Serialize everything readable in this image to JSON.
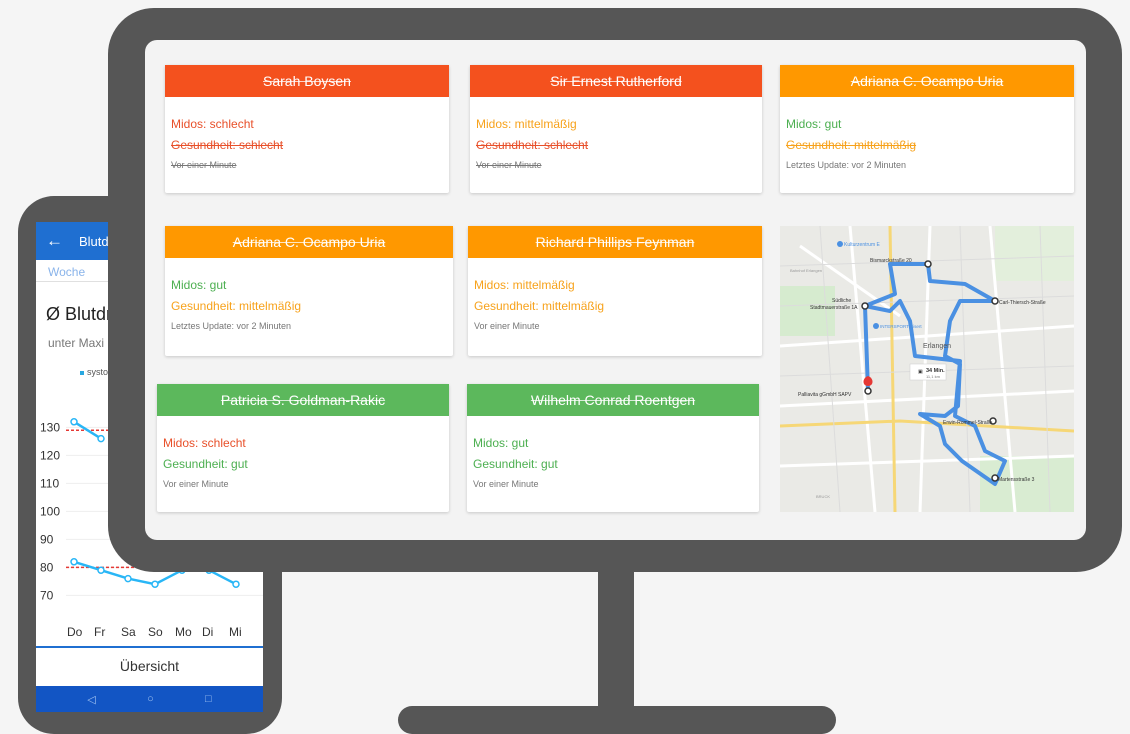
{
  "colors": {
    "red": "#f4511e",
    "orange": "#ff9800",
    "green": "#5cb85c",
    "status_red": "#e8502a",
    "status_orange": "#f7a21b",
    "status_green": "#4caf50",
    "frame": "#565656",
    "phone_blue": "#1f6fd1",
    "route_blue": "#4a90e2"
  },
  "phone": {
    "title": "Blutdr",
    "tab": "Woche",
    "heading": "Ø Blutdr",
    "subtitle": "unter Maxi",
    "legend": "systo",
    "bottom_button": "Übersicht",
    "nav_icons": [
      "back-triangle",
      "home-circle",
      "recents-square"
    ],
    "nav_glyphs": [
      "◁",
      "○",
      "□"
    ]
  },
  "chart_data": {
    "type": "line",
    "categories": [
      "Do",
      "Fr",
      "Sa",
      "So",
      "Mo",
      "Di",
      "Mi"
    ],
    "yticks": [
      130,
      120,
      110,
      100,
      90,
      80,
      70
    ],
    "ylim": [
      68,
      133
    ],
    "series": [
      {
        "name": "systo",
        "values": [
          132,
          126,
          null,
          null,
          null,
          null,
          null
        ]
      },
      {
        "values": [
          82,
          79,
          76,
          74,
          79,
          79,
          74
        ]
      }
    ],
    "reference_lines": [
      129,
      80
    ]
  },
  "cards": [
    {
      "name": "Sarah Boysen",
      "color": "red",
      "line1": "Midos: schlecht",
      "line1_color": "status_red",
      "line2": "Gesundheit: schlecht",
      "line2_color": "status_red",
      "line2_strike": true,
      "footer": "Vor einer Minute",
      "footer_strike": true
    },
    {
      "name": "Sir Ernest Rutherford",
      "color": "red",
      "line1": "Midos: mittelmäßig",
      "line1_color": "status_orange",
      "line2": "Gesundheit: schlecht",
      "line2_color": "status_red",
      "line2_strike": true,
      "footer": "Vor einer Minute",
      "footer_strike": true
    },
    {
      "name": "Adriana C. Ocampo Uria",
      "color": "orange",
      "line1": "Midos: gut",
      "line1_color": "status_green",
      "line2": "Gesundheit: mittelmäßig",
      "line2_color": "status_orange",
      "line2_strike": true,
      "footer": "Letztes Update: vor 2 Minuten",
      "footer_strike": false
    },
    {
      "name": "Adriana C. Ocampo Uria",
      "color": "orange",
      "line1": "Midos: gut",
      "line1_color": "status_green",
      "line2": "Gesundheit: mittelmäßig",
      "line2_color": "status_orange",
      "line2_strike": false,
      "footer": "Letztes Update: vor 2 Minuten",
      "footer_strike": false
    },
    {
      "name": "Richard Phillips Feynman",
      "color": "orange",
      "line1": "Midos: mittelmäßig",
      "line1_color": "status_orange",
      "line2": "Gesundheit: mittelmäßig",
      "line2_color": "status_orange",
      "line2_strike": false,
      "footer": "Vor einer Minute",
      "footer_strike": false
    },
    {
      "name": "Patricia S. Goldman-Rakic",
      "color": "green",
      "line1": "Midos: schlecht",
      "line1_color": "status_red",
      "line2": "Gesundheit: gut",
      "line2_color": "status_green",
      "line2_strike": false,
      "footer": "Vor einer Minute",
      "footer_strike": false
    },
    {
      "name": "Wilhelm Conrad Roentgen",
      "color": "green",
      "line1": "Midos: gut",
      "line1_color": "status_green",
      "line2": "Gesundheit: gut",
      "line2_color": "status_green",
      "line2_strike": false,
      "footer": "Vor einer Minute",
      "footer_strike": false
    }
  ],
  "map": {
    "labels": {
      "kultur": "Kulturzentrum E",
      "bismarck": "Bismarckstraße 20",
      "carl": "Carl-Thiersch-Straße",
      "suedliche1": "Südliche",
      "suedliche2": "Stadtmauerstraße 1A",
      "intersport": "INTERSPORT Eisert",
      "erlangen": "Erlangen",
      "time": "34 Min.",
      "dist": "11,1 km",
      "palliavita": "Palliavita gGmbH SAPV",
      "erwin": "Erwin-Rommel-Straße",
      "martens": "Martensstraße 3",
      "bruck": "BRUCK",
      "bahnhof": "Bahnhof Erlangen"
    }
  }
}
